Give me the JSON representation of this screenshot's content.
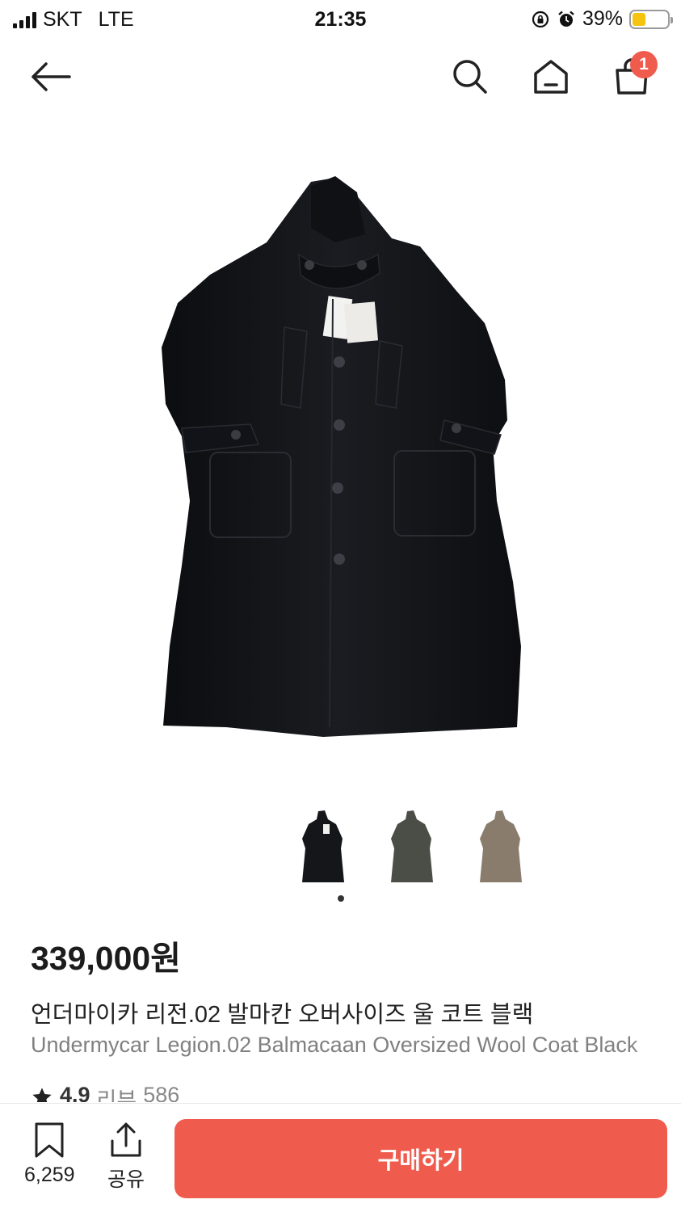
{
  "status_bar": {
    "carrier": "SKT",
    "network": "LTE",
    "time": "21:35",
    "battery_percent": "39%",
    "battery_level": 0.39,
    "icons": [
      "signal-icon",
      "rotation-lock-icon",
      "alarm-icon",
      "battery-icon"
    ]
  },
  "nav": {
    "icons": [
      "back-arrow-icon",
      "search-icon",
      "home-icon",
      "shopping-bag-icon"
    ],
    "cart_count": "1"
  },
  "product": {
    "image_icon": "black-wool-coat-image",
    "thumbnails": [
      {
        "color_name": "black",
        "color": "#15161a"
      },
      {
        "color_name": "olive-gray",
        "color": "#4b4e47"
      },
      {
        "color_name": "taupe",
        "color": "#8a7c6c"
      }
    ],
    "price": "339,000원",
    "name_ko": "언더마이카 리전.02 발마칸 오버사이즈 울 코트 블랙",
    "name_en": "Undermycar Legion.02 Balmacaan Oversized Wool Coat Black",
    "rating": "4.9",
    "review_label": "리뷰",
    "review_count": "586"
  },
  "bottom_bar": {
    "bookmark_count": "6,259",
    "share_label": "공유",
    "buy_label": "구매하기",
    "accent_color": "#ef5c4e"
  }
}
